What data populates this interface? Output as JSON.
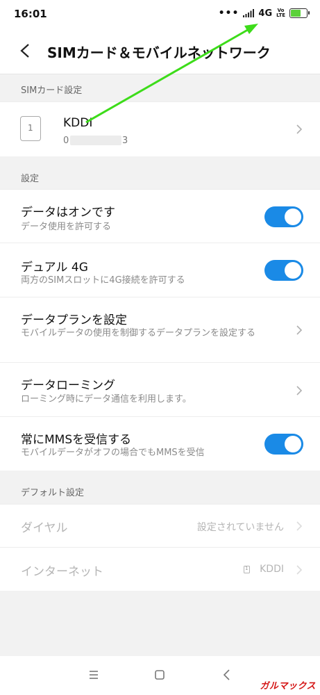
{
  "status_bar": {
    "time": "16:01",
    "signal_dots": "•••",
    "network": "4G",
    "volte_top": "Vo",
    "volte_bottom": "LTE",
    "battery_state": "charging"
  },
  "header": {
    "title": "SIMカード＆モバイルネットワーク",
    "back_icon": "chevron-left-icon"
  },
  "sim_section": {
    "label": "SIMカード設定",
    "card": {
      "slot": "1",
      "carrier": "KDDI",
      "number_prefix": "0",
      "number_suffix": "3"
    }
  },
  "settings_section": {
    "label": "設定",
    "items": [
      {
        "title": "データはオンです",
        "subtitle": "データ使用を許可する",
        "control": "toggle",
        "on": true
      },
      {
        "title": "デュアル 4G",
        "subtitle": "両方のSIMスロットに4G接続を許可する",
        "control": "toggle",
        "on": true
      },
      {
        "title": "データプランを設定",
        "subtitle": "モバイルデータの使用を制御するデータプランを設定する",
        "control": "chevron"
      },
      {
        "title": "データローミング",
        "subtitle": "ローミング時にデータ通信を利用します。",
        "control": "chevron"
      },
      {
        "title": "常にMMSを受信する",
        "subtitle": "モバイルデータがオフの場合でもMMSを受信",
        "control": "toggle",
        "on": true
      }
    ]
  },
  "default_section": {
    "label": "デフォルト設定",
    "items": [
      {
        "title": "ダイヤル",
        "value": "設定されていません"
      },
      {
        "title": "インターネット",
        "value": "KDDI",
        "sim_slot": "1"
      }
    ]
  },
  "navbar": {
    "menu_icon": "menu-icon",
    "home_icon": "home-square-icon",
    "back_icon": "back-triangle-icon"
  },
  "watermark": "ガルマックス",
  "colors": {
    "toggle_on": "#1a8ae6",
    "annotation_arrow": "#3ddc1a",
    "watermark": "#d41616"
  }
}
